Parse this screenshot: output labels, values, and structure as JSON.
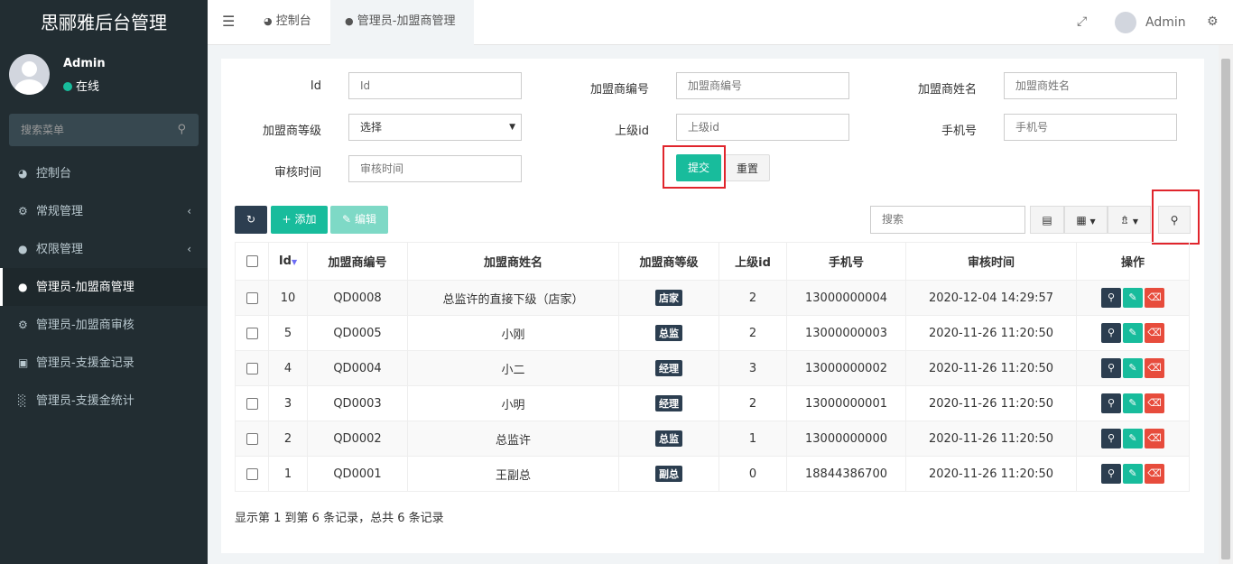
{
  "app": {
    "title": "思郦雅后台管理"
  },
  "user": {
    "name": "Admin",
    "status": "在线"
  },
  "sidebar": {
    "search_placeholder": "搜索菜单",
    "items": [
      {
        "label": "控制台",
        "icon": "dashboard-icon"
      },
      {
        "label": "常规管理",
        "icon": "cogs-icon"
      },
      {
        "label": "权限管理",
        "icon": "users-icon"
      },
      {
        "label": "管理员-加盟商管理",
        "icon": "users-icon"
      },
      {
        "label": "管理员-加盟商审核",
        "icon": "gear-icon"
      },
      {
        "label": "管理员-支援金记录",
        "icon": "money-icon"
      },
      {
        "label": "管理员-支援金统计",
        "icon": "bar-chart-icon"
      }
    ]
  },
  "topbar": {
    "tabs": [
      {
        "label": "控制台"
      },
      {
        "label": "管理员-加盟商管理"
      }
    ],
    "user_name": "Admin"
  },
  "filter": {
    "id_label": "Id",
    "id_placeholder": "Id",
    "code_label": "加盟商编号",
    "code_placeholder": "加盟商编号",
    "name_label": "加盟商姓名",
    "name_placeholder": "加盟商姓名",
    "level_label": "加盟商等级",
    "level_value": "选择",
    "parent_label": "上级id",
    "parent_placeholder": "上级id",
    "phone_label": "手机号",
    "phone_placeholder": "手机号",
    "time_label": "审核时间",
    "time_placeholder": "审核时间",
    "submit": "提交",
    "reset": "重置"
  },
  "toolbar": {
    "add": "添加",
    "edit": "编辑",
    "search_placeholder": "搜索"
  },
  "table": {
    "headers": [
      "Id",
      "加盟商编号",
      "加盟商姓名",
      "加盟商等级",
      "上级id",
      "手机号",
      "审核时间",
      "操作"
    ],
    "rows": [
      {
        "id": "10",
        "code": "QD0008",
        "name": "总监许的直接下级（店家）",
        "level": "店家",
        "parent": "2",
        "phone": "13000000004",
        "time": "2020-12-04 14:29:57"
      },
      {
        "id": "5",
        "code": "QD0005",
        "name": "小刚",
        "level": "总监",
        "parent": "2",
        "phone": "13000000003",
        "time": "2020-11-26 11:20:50"
      },
      {
        "id": "4",
        "code": "QD0004",
        "name": "小二",
        "level": "经理",
        "parent": "3",
        "phone": "13000000002",
        "time": "2020-11-26 11:20:50"
      },
      {
        "id": "3",
        "code": "QD0003",
        "name": "小明",
        "level": "经理",
        "parent": "2",
        "phone": "13000000001",
        "time": "2020-11-26 11:20:50"
      },
      {
        "id": "2",
        "code": "QD0002",
        "name": "总监许",
        "level": "总监",
        "parent": "1",
        "phone": "13000000000",
        "time": "2020-11-26 11:20:50"
      },
      {
        "id": "1",
        "code": "QD0001",
        "name": "王副总",
        "level": "副总",
        "parent": "0",
        "phone": "18844386700",
        "time": "2020-11-26 11:20:50"
      }
    ]
  },
  "pagination": {
    "info": "显示第 1 到第 6 条记录，总共 6 条记录"
  },
  "colors": {
    "sidebar": "#222d32",
    "primary": "#18bc9c",
    "dark": "#2c3e50",
    "danger": "#e74c3c",
    "highlight": "#e0252c"
  }
}
